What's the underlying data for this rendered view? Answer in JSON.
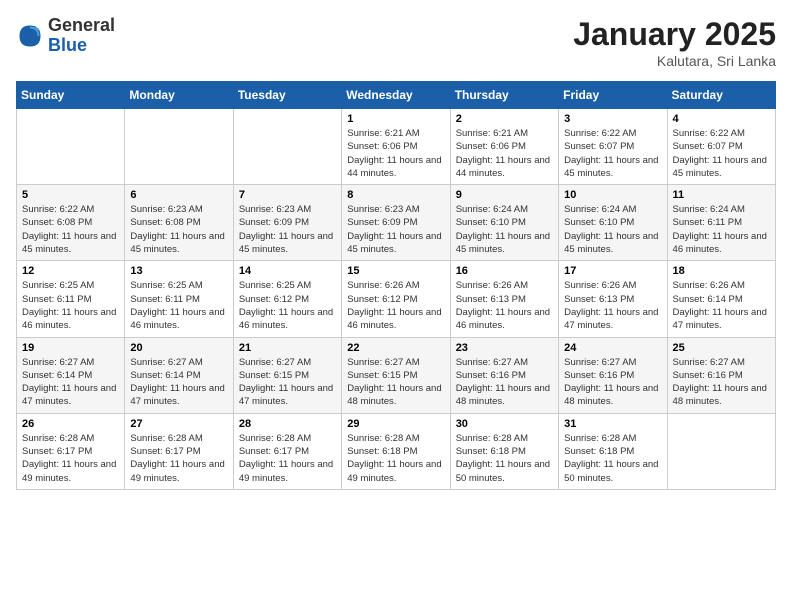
{
  "header": {
    "logo": {
      "general": "General",
      "blue": "Blue"
    },
    "title": "January 2025",
    "subtitle": "Kalutara, Sri Lanka"
  },
  "weekdays": [
    "Sunday",
    "Monday",
    "Tuesday",
    "Wednesday",
    "Thursday",
    "Friday",
    "Saturday"
  ],
  "weeks": [
    [
      {
        "day": "",
        "sunrise": "",
        "sunset": "",
        "daylight": ""
      },
      {
        "day": "",
        "sunrise": "",
        "sunset": "",
        "daylight": ""
      },
      {
        "day": "",
        "sunrise": "",
        "sunset": "",
        "daylight": ""
      },
      {
        "day": "1",
        "sunrise": "Sunrise: 6:21 AM",
        "sunset": "Sunset: 6:06 PM",
        "daylight": "Daylight: 11 hours and 44 minutes."
      },
      {
        "day": "2",
        "sunrise": "Sunrise: 6:21 AM",
        "sunset": "Sunset: 6:06 PM",
        "daylight": "Daylight: 11 hours and 44 minutes."
      },
      {
        "day": "3",
        "sunrise": "Sunrise: 6:22 AM",
        "sunset": "Sunset: 6:07 PM",
        "daylight": "Daylight: 11 hours and 45 minutes."
      },
      {
        "day": "4",
        "sunrise": "Sunrise: 6:22 AM",
        "sunset": "Sunset: 6:07 PM",
        "daylight": "Daylight: 11 hours and 45 minutes."
      }
    ],
    [
      {
        "day": "5",
        "sunrise": "Sunrise: 6:22 AM",
        "sunset": "Sunset: 6:08 PM",
        "daylight": "Daylight: 11 hours and 45 minutes."
      },
      {
        "day": "6",
        "sunrise": "Sunrise: 6:23 AM",
        "sunset": "Sunset: 6:08 PM",
        "daylight": "Daylight: 11 hours and 45 minutes."
      },
      {
        "day": "7",
        "sunrise": "Sunrise: 6:23 AM",
        "sunset": "Sunset: 6:09 PM",
        "daylight": "Daylight: 11 hours and 45 minutes."
      },
      {
        "day": "8",
        "sunrise": "Sunrise: 6:23 AM",
        "sunset": "Sunset: 6:09 PM",
        "daylight": "Daylight: 11 hours and 45 minutes."
      },
      {
        "day": "9",
        "sunrise": "Sunrise: 6:24 AM",
        "sunset": "Sunset: 6:10 PM",
        "daylight": "Daylight: 11 hours and 45 minutes."
      },
      {
        "day": "10",
        "sunrise": "Sunrise: 6:24 AM",
        "sunset": "Sunset: 6:10 PM",
        "daylight": "Daylight: 11 hours and 45 minutes."
      },
      {
        "day": "11",
        "sunrise": "Sunrise: 6:24 AM",
        "sunset": "Sunset: 6:11 PM",
        "daylight": "Daylight: 11 hours and 46 minutes."
      }
    ],
    [
      {
        "day": "12",
        "sunrise": "Sunrise: 6:25 AM",
        "sunset": "Sunset: 6:11 PM",
        "daylight": "Daylight: 11 hours and 46 minutes."
      },
      {
        "day": "13",
        "sunrise": "Sunrise: 6:25 AM",
        "sunset": "Sunset: 6:11 PM",
        "daylight": "Daylight: 11 hours and 46 minutes."
      },
      {
        "day": "14",
        "sunrise": "Sunrise: 6:25 AM",
        "sunset": "Sunset: 6:12 PM",
        "daylight": "Daylight: 11 hours and 46 minutes."
      },
      {
        "day": "15",
        "sunrise": "Sunrise: 6:26 AM",
        "sunset": "Sunset: 6:12 PM",
        "daylight": "Daylight: 11 hours and 46 minutes."
      },
      {
        "day": "16",
        "sunrise": "Sunrise: 6:26 AM",
        "sunset": "Sunset: 6:13 PM",
        "daylight": "Daylight: 11 hours and 46 minutes."
      },
      {
        "day": "17",
        "sunrise": "Sunrise: 6:26 AM",
        "sunset": "Sunset: 6:13 PM",
        "daylight": "Daylight: 11 hours and 47 minutes."
      },
      {
        "day": "18",
        "sunrise": "Sunrise: 6:26 AM",
        "sunset": "Sunset: 6:14 PM",
        "daylight": "Daylight: 11 hours and 47 minutes."
      }
    ],
    [
      {
        "day": "19",
        "sunrise": "Sunrise: 6:27 AM",
        "sunset": "Sunset: 6:14 PM",
        "daylight": "Daylight: 11 hours and 47 minutes."
      },
      {
        "day": "20",
        "sunrise": "Sunrise: 6:27 AM",
        "sunset": "Sunset: 6:14 PM",
        "daylight": "Daylight: 11 hours and 47 minutes."
      },
      {
        "day": "21",
        "sunrise": "Sunrise: 6:27 AM",
        "sunset": "Sunset: 6:15 PM",
        "daylight": "Daylight: 11 hours and 47 minutes."
      },
      {
        "day": "22",
        "sunrise": "Sunrise: 6:27 AM",
        "sunset": "Sunset: 6:15 PM",
        "daylight": "Daylight: 11 hours and 48 minutes."
      },
      {
        "day": "23",
        "sunrise": "Sunrise: 6:27 AM",
        "sunset": "Sunset: 6:16 PM",
        "daylight": "Daylight: 11 hours and 48 minutes."
      },
      {
        "day": "24",
        "sunrise": "Sunrise: 6:27 AM",
        "sunset": "Sunset: 6:16 PM",
        "daylight": "Daylight: 11 hours and 48 minutes."
      },
      {
        "day": "25",
        "sunrise": "Sunrise: 6:27 AM",
        "sunset": "Sunset: 6:16 PM",
        "daylight": "Daylight: 11 hours and 48 minutes."
      }
    ],
    [
      {
        "day": "26",
        "sunrise": "Sunrise: 6:28 AM",
        "sunset": "Sunset: 6:17 PM",
        "daylight": "Daylight: 11 hours and 49 minutes."
      },
      {
        "day": "27",
        "sunrise": "Sunrise: 6:28 AM",
        "sunset": "Sunset: 6:17 PM",
        "daylight": "Daylight: 11 hours and 49 minutes."
      },
      {
        "day": "28",
        "sunrise": "Sunrise: 6:28 AM",
        "sunset": "Sunset: 6:17 PM",
        "daylight": "Daylight: 11 hours and 49 minutes."
      },
      {
        "day": "29",
        "sunrise": "Sunrise: 6:28 AM",
        "sunset": "Sunset: 6:18 PM",
        "daylight": "Daylight: 11 hours and 49 minutes."
      },
      {
        "day": "30",
        "sunrise": "Sunrise: 6:28 AM",
        "sunset": "Sunset: 6:18 PM",
        "daylight": "Daylight: 11 hours and 50 minutes."
      },
      {
        "day": "31",
        "sunrise": "Sunrise: 6:28 AM",
        "sunset": "Sunset: 6:18 PM",
        "daylight": "Daylight: 11 hours and 50 minutes."
      },
      {
        "day": "",
        "sunrise": "",
        "sunset": "",
        "daylight": ""
      }
    ]
  ]
}
